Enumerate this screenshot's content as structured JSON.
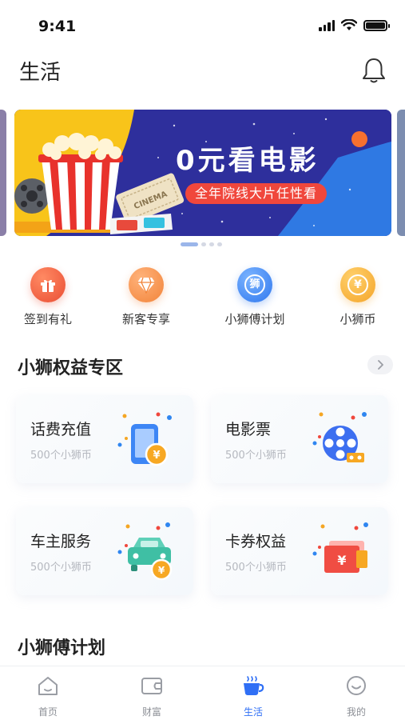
{
  "status_bar": {
    "time": "9:41"
  },
  "header": {
    "title": "生活"
  },
  "banner": {
    "headline": "0元看电影",
    "tagline": "全年院线大片任性看",
    "ticket_text": "CINEMA",
    "active_index": 1,
    "page_count": 4
  },
  "quick_entries": [
    {
      "label": "签到有礼",
      "icon": "gift-icon",
      "color": "#f2624a"
    },
    {
      "label": "新客专享",
      "icon": "diamond-icon",
      "color": "#f59a3e"
    },
    {
      "label": "小狮傅计划",
      "icon": "lion-badge-icon",
      "color": "#3f8ef5",
      "glyph": "狮"
    },
    {
      "label": "小狮币",
      "icon": "coin-icon",
      "color": "#f7b23b",
      "glyph": "¥"
    }
  ],
  "benefits_section": {
    "title": "小狮权益专区"
  },
  "benefit_cards": [
    {
      "title": "话费充值",
      "subtitle": "500个小狮币",
      "icon": "phone-recharge-icon"
    },
    {
      "title": "电影票",
      "subtitle": "500个小狮币",
      "icon": "film-reel-icon"
    },
    {
      "title": "车主服务",
      "subtitle": "500个小狮币",
      "icon": "car-service-icon"
    },
    {
      "title": "卡券权益",
      "subtitle": "500个小狮币",
      "icon": "coupon-icon"
    }
  ],
  "plan_section": {
    "title": "小狮傅计划"
  },
  "tabs": [
    {
      "label": "首页",
      "icon": "home-icon",
      "active": false
    },
    {
      "label": "财富",
      "icon": "wallet-icon",
      "active": false
    },
    {
      "label": "生活",
      "icon": "coffee-cup-icon",
      "active": true
    },
    {
      "label": "我的",
      "icon": "smiley-icon",
      "active": false
    }
  ],
  "colors": {
    "accent": "#2f6ff5",
    "banner_bg": "#2e2f9c",
    "banner_pill": "#f0473c",
    "coin": "#f7a823"
  }
}
